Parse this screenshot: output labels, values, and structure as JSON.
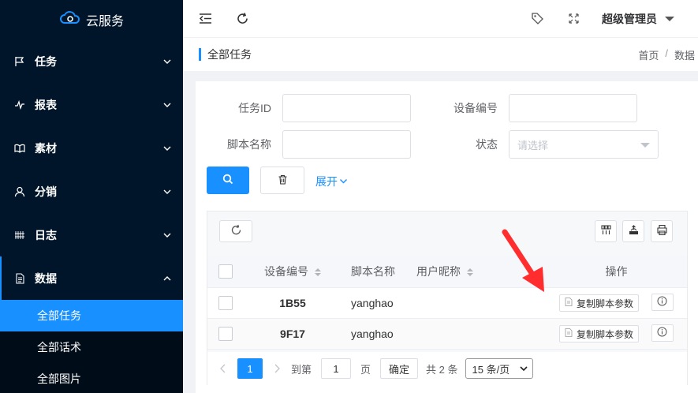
{
  "app": {
    "name": "云服务"
  },
  "sidebar": {
    "items": [
      {
        "label": "任务",
        "icon": "flag-icon"
      },
      {
        "label": "报表",
        "icon": "pulse-icon"
      },
      {
        "label": "素材",
        "icon": "book-icon"
      },
      {
        "label": "分销",
        "icon": "user-icon"
      },
      {
        "label": "日志",
        "icon": "grid-icon"
      },
      {
        "label": "数据",
        "icon": "document-icon"
      }
    ],
    "subitems": [
      {
        "label": "全部任务",
        "active": true
      },
      {
        "label": "全部话术",
        "active": false
      },
      {
        "label": "全部图片",
        "active": false
      }
    ],
    "active_color": "#1890ff",
    "bg_color": "#001529"
  },
  "header": {
    "user": "超级管理员"
  },
  "breadcrumb": {
    "title": "全部任务",
    "home": "首页",
    "sep": "/",
    "current": "数据"
  },
  "filters": {
    "task_id_label": "任务ID",
    "device_label": "设备编号",
    "script_label": "脚本名称",
    "status_label": "状态",
    "status_placeholder": "请选择",
    "expand_label": "展开"
  },
  "table": {
    "headers": {
      "device": "设备编号",
      "script": "脚本名称",
      "nickname": "用户昵称",
      "actions": "操作"
    },
    "rows": [
      {
        "device": "1B55",
        "script": "yanghao",
        "nickname": "",
        "copy": "复制脚本参数"
      },
      {
        "device": "9F17",
        "script": "yanghao",
        "nickname": "",
        "copy": "复制脚本参数"
      }
    ]
  },
  "pager": {
    "page": "1",
    "goto": "到第",
    "goto_value": "1",
    "page_unit": "页",
    "confirm": "确定",
    "total": "共 2 条",
    "size": "15 条/页"
  }
}
